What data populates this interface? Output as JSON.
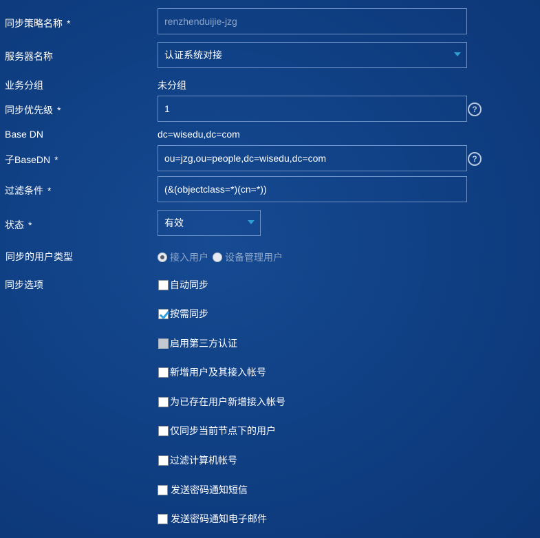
{
  "form": {
    "policy_name": {
      "label": "同步策略名称",
      "required": "*",
      "value": "renzhenduijie-jzg"
    },
    "server_name": {
      "label": "服务器名称",
      "value": "认证系统对接"
    },
    "business_group": {
      "label": "业务分组",
      "value": "未分组"
    },
    "priority": {
      "label": "同步优先级",
      "required": "*",
      "value": "1",
      "help": "?"
    },
    "base_dn": {
      "label": "Base DN",
      "value": "dc=wisedu,dc=com"
    },
    "sub_base_dn": {
      "label": "子BaseDN",
      "required": "*",
      "value": "ou=jzg,ou=people,dc=wisedu,dc=com",
      "help": "?"
    },
    "filter": {
      "label": "过滤条件",
      "required": "*",
      "value": "(&(objectclass=*)(cn=*))"
    },
    "status": {
      "label": "状态",
      "required": "*",
      "value": "有效"
    },
    "user_type": {
      "label": "同步的用户类型",
      "options": [
        {
          "label": "接入用户",
          "selected": true
        },
        {
          "label": "设备管理用户",
          "selected": false
        }
      ]
    },
    "sync_options": {
      "label": "同步选项",
      "items": [
        {
          "label": "自动同步",
          "checked": false
        },
        {
          "label": "按需同步",
          "checked": true
        },
        {
          "label": "启用第三方认证",
          "checked": false,
          "disabled": true
        },
        {
          "label": "新增用户及其接入帐号",
          "checked": false
        },
        {
          "label": "为已存在用户新增接入帐号",
          "checked": false
        },
        {
          "label": "仅同步当前节点下的用户",
          "checked": false
        },
        {
          "label": "过滤计算机帐号",
          "checked": false
        },
        {
          "label": "发送密码通知短信",
          "checked": false
        },
        {
          "label": "发送密码通知电子邮件",
          "checked": false
        }
      ]
    }
  },
  "colors": {
    "background": "#0f3e82",
    "field_border": "#6f93c6",
    "accent": "#2e9ed1"
  }
}
